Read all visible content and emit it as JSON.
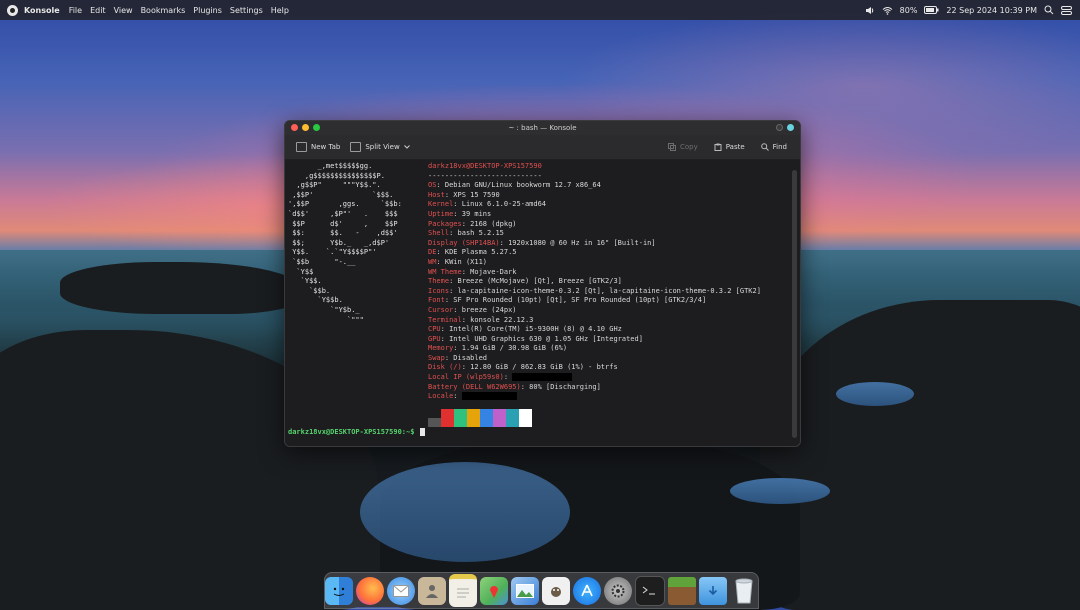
{
  "menubar": {
    "app_name": "Konsole",
    "menu_items": [
      "File",
      "Edit",
      "View",
      "Bookmarks",
      "Plugins",
      "Settings",
      "Help"
    ],
    "battery_percent": "80%",
    "date_time": "22 Sep 2024 10:39 PM"
  },
  "window": {
    "title": "~ : bash — Konsole",
    "toolbar": {
      "new_tab": "New Tab",
      "split_view": "Split View",
      "copy": "Copy",
      "paste": "Paste",
      "find": "Find"
    }
  },
  "terminal": {
    "logo_lines": [
      "       _,met$$$$$gg.",
      "    ,g$$$$$$$$$$$$$$$P.",
      "  ,g$$P\"     \"\"\"Y$$.\".",
      " ,$$P'              `$$$.",
      "',$$P       ,ggs.     `$$b:",
      "`d$$'     ,$P\"'   .    $$$",
      " $$P      d$'     ,    $$P",
      " $$:      $$.   -    ,d$$'",
      " $$;      Y$b._   _,d$P'",
      " Y$$.    `.`\"Y$$$$P\"'",
      " `$$b      \"-.__",
      "  `Y$$",
      "   `Y$$.",
      "     `$$b.",
      "       `Y$$b.",
      "          `\"Y$b._",
      "              `\"\"\""
    ],
    "user_host": "darkz18vx@DESKTOP-XPS157590",
    "separator": "---------------------------",
    "info": [
      {
        "key": "OS",
        "value": "Debian GNU/Linux bookworm 12.7 x86_64"
      },
      {
        "key": "Host",
        "value": "XPS 15 7590"
      },
      {
        "key": "Kernel",
        "value": "Linux 6.1.0-25-amd64"
      },
      {
        "key": "Uptime",
        "value": "39 mins"
      },
      {
        "key": "Packages",
        "value": "2168 (dpkg)"
      },
      {
        "key": "Shell",
        "value": "bash 5.2.15"
      },
      {
        "key": "Display (SHP14BA)",
        "value": "1920x1080 @ 60 Hz in 16\" [Built-in]"
      },
      {
        "key": "DE",
        "value": "KDE Plasma 5.27.5"
      },
      {
        "key": "WM",
        "value": "KWin (X11)"
      },
      {
        "key": "WM Theme",
        "value": "Mojave-Dark"
      },
      {
        "key": "Theme",
        "value": "Breeze (McMojave) [Qt], Breeze [GTK2/3]"
      },
      {
        "key": "Icons",
        "value": "la-capitaine-icon-theme-0.3.2 [Qt], la-capitaine-icon-theme-0.3.2 [GTK2]"
      },
      {
        "key": "Font",
        "value": "SF Pro Rounded (10pt) [Qt], SF Pro Rounded (10pt) [GTK2/3/4]"
      },
      {
        "key": "Cursor",
        "value": "breeze (24px)"
      },
      {
        "key": "Terminal",
        "value": "konsole 22.12.3"
      },
      {
        "key": "CPU",
        "value": "Intel(R) Core(TM) i5-9300H (8) @ 4.10 GHz"
      },
      {
        "key": "GPU",
        "value": "Intel UHD Graphics 630 @ 1.05 GHz [Integrated]"
      },
      {
        "key": "Memory",
        "value": "1.94 GiB / 30.98 GiB (6%)"
      },
      {
        "key": "Swap",
        "value": "Disabled"
      },
      {
        "key": "Disk (/)",
        "value": "12.80 GiB / 862.83 GiB (1%) - btrfs"
      },
      {
        "key": "Local IP (wlp59s0)",
        "value": ""
      },
      {
        "key": "Battery (DELL W62W695)",
        "value": "80% [Discharging]"
      },
      {
        "key": "Locale",
        "value": ""
      }
    ],
    "palette_colors": [
      "#555555",
      "#e03030",
      "#2ec27e",
      "#e5a50a",
      "#3584e4",
      "#c061cb",
      "#2aa1b3",
      "#ffffff"
    ],
    "prompt": "darkz18vx@DESKTOP-XPS157590:~$"
  },
  "dock": {
    "apps": [
      "finder-icon",
      "firefox-icon",
      "mail-icon",
      "contacts-icon",
      "notes-icon",
      "maps-icon",
      "photos-icon",
      "gimp-icon",
      "app-store-icon",
      "system-settings-icon",
      "terminal-icon",
      "minecraft-icon",
      "downloads-folder-icon",
      "trash-icon"
    ]
  }
}
